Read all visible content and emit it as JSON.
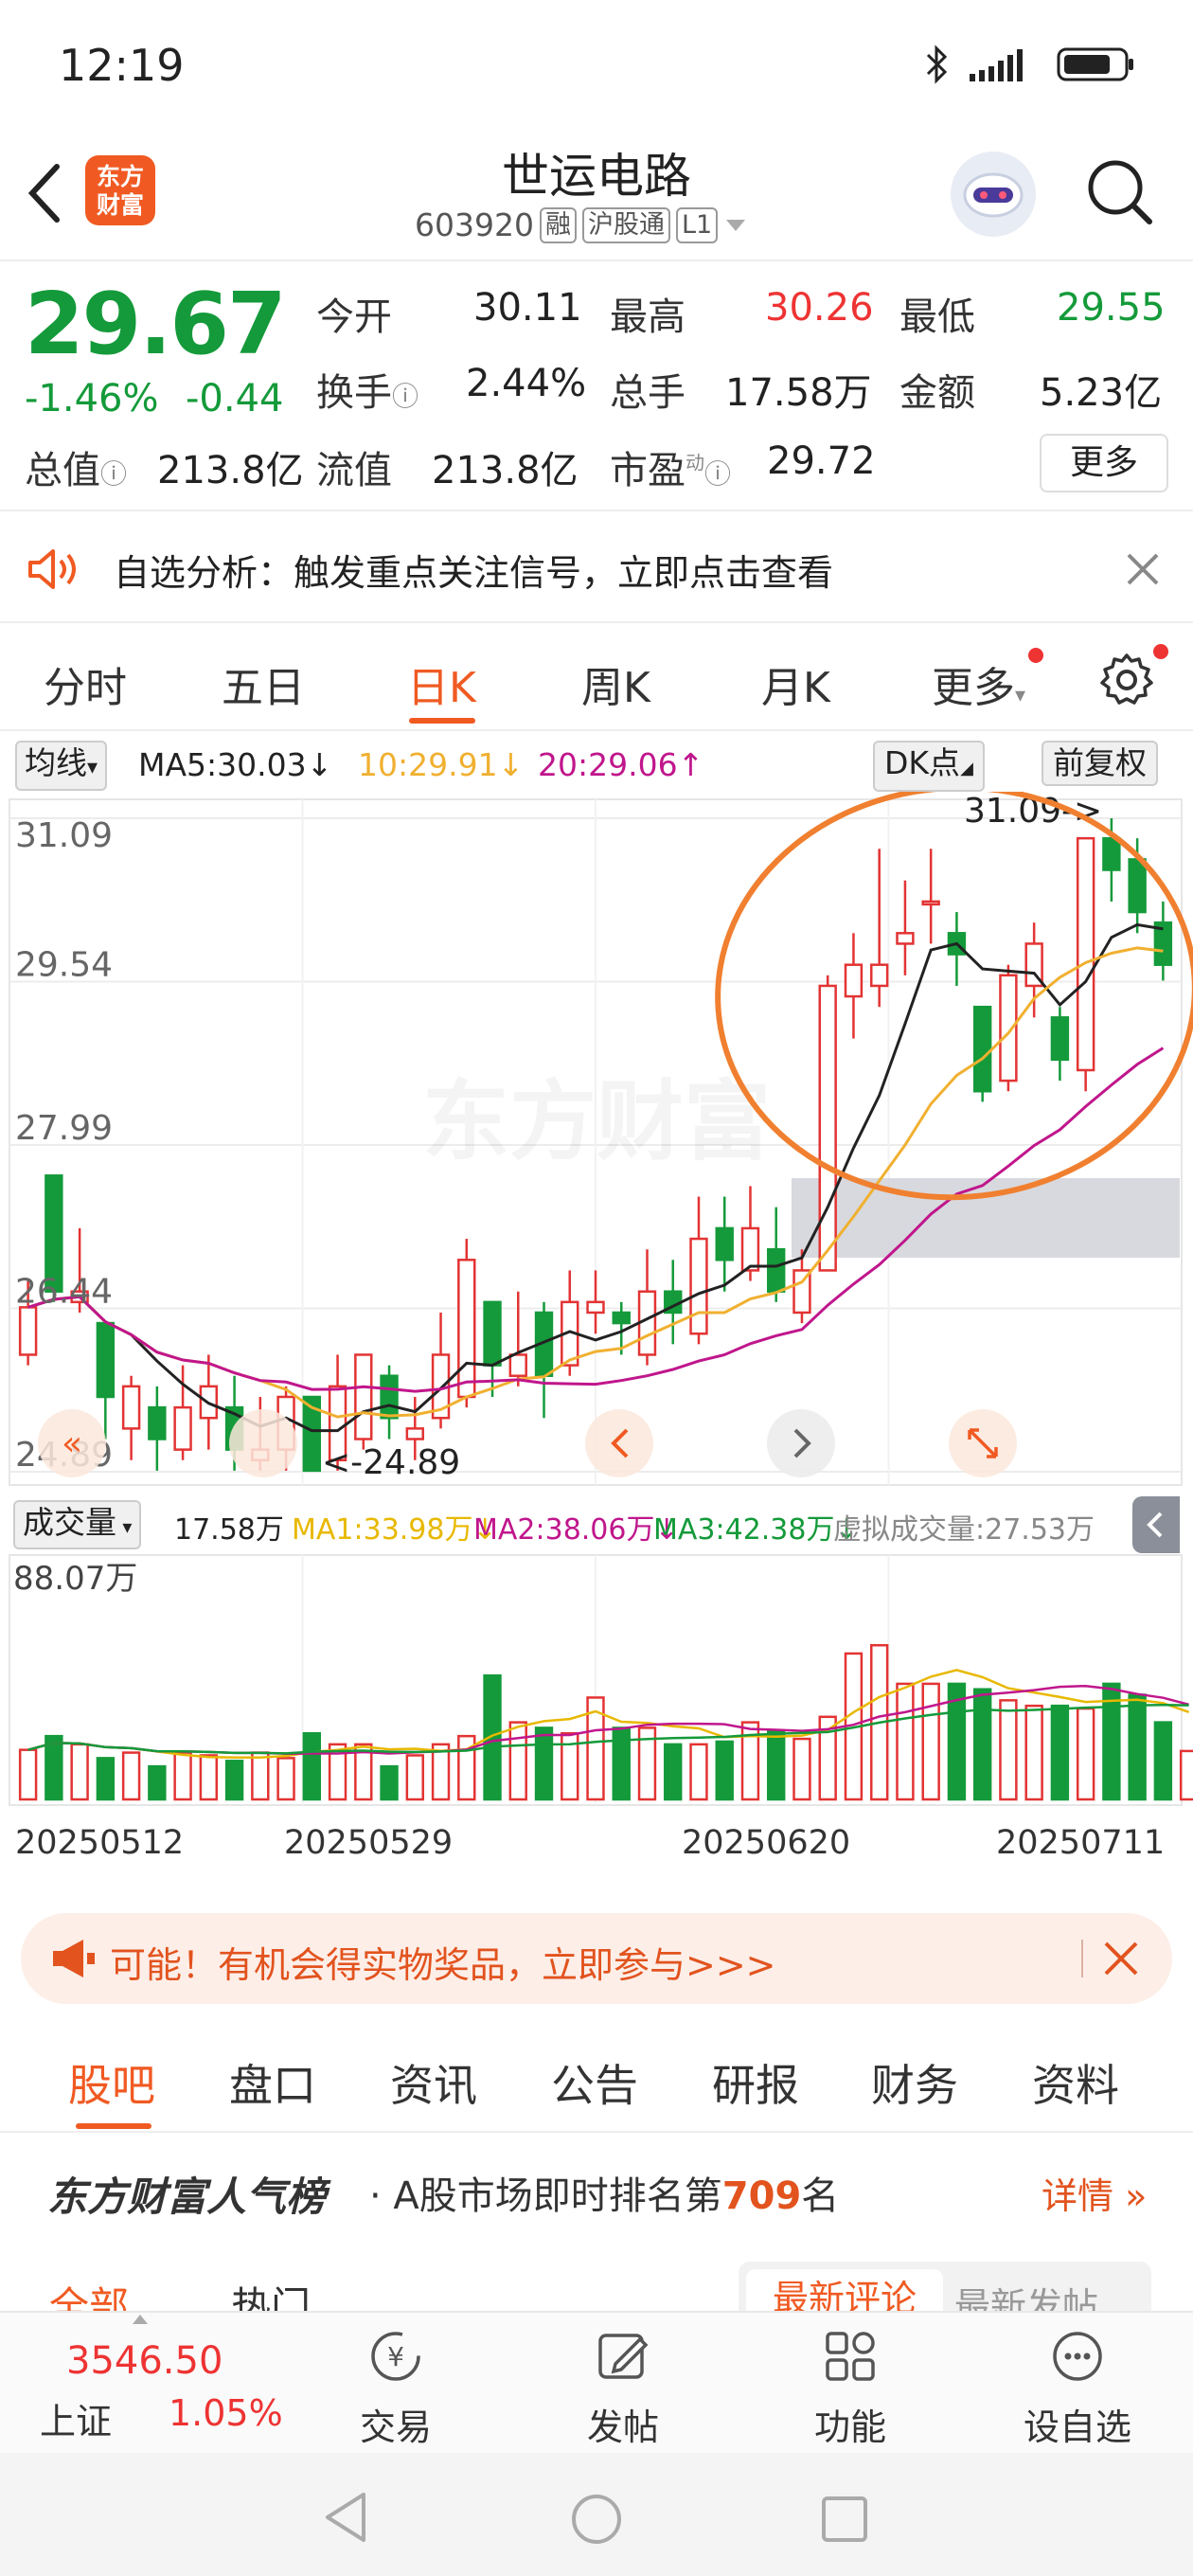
{
  "status_bar": {
    "time": "12:19"
  },
  "header": {
    "title": "世运电路",
    "code": "603920",
    "tags": [
      "融",
      "沪股通",
      "L1"
    ],
    "logo_text": "东方财富"
  },
  "quote": {
    "price": "29.67",
    "change_pct": "-1.46%",
    "change": "-0.44",
    "fields": [
      {
        "label": "今开",
        "value": "30.11"
      },
      {
        "label": "最高",
        "value": "30.26"
      },
      {
        "label": "最低",
        "value": "29.55"
      },
      {
        "label": "换手",
        "value": "2.44%"
      },
      {
        "label": "总手",
        "value": "17.58万"
      },
      {
        "label": "金额",
        "value": "5.23亿"
      },
      {
        "label": "总值",
        "value": "213.8亿"
      },
      {
        "label": "流值",
        "value": "213.8亿"
      },
      {
        "label": "市盈",
        "sup": "动",
        "value": "29.72"
      }
    ],
    "more_label": "更多"
  },
  "notice": {
    "text": "自选分析：触发重点关注信号，立即点击查看"
  },
  "period_tabs": [
    "分时",
    "五日",
    "日K",
    "周K",
    "月K",
    "更多"
  ],
  "active_period": "日K",
  "ma_legend": {
    "selector": "均线",
    "ma5": "MA5:30.03↓",
    "ma10": "10:29.91↓",
    "ma20": "20:29.06↑",
    "dk_label": "DK点",
    "adjust_label": "前复权"
  },
  "kline": {
    "y_ticks": [
      "31.09",
      "29.54",
      "27.99",
      "26.44",
      "24.89"
    ],
    "high_marker": "31.09->",
    "low_marker": "<-24.89",
    "watermark": "东方财富",
    "colors": {
      "up": "#e33333",
      "down": "#149a3a",
      "ma5": "#222222",
      "ma10": "#f0b030",
      "ma20": "#c0168c",
      "annotation": "#f08030"
    }
  },
  "volume": {
    "selector": "成交量",
    "current": "17.58万",
    "ma1": "MA1:33.98万↓",
    "ma2": "MA2:38.06万↓",
    "ma3": "MA3:42.38万↓",
    "virtual": "虚拟成交量:27.53万",
    "y_max_label": "88.07万"
  },
  "dates": [
    "20250512",
    "20250529",
    "20250620",
    "20250711"
  ],
  "chart_data": {
    "type": "candlestick",
    "ylim": [
      24.89,
      31.09
    ],
    "candles": [
      {
        "o": 26.0,
        "c": 26.45,
        "h": 26.7,
        "l": 25.9
      },
      {
        "o": 27.7,
        "c": 26.6,
        "h": 27.7,
        "l": 26.5
      },
      {
        "o": 26.5,
        "c": 26.6,
        "h": 27.2,
        "l": 26.4
      },
      {
        "o": 26.3,
        "c": 25.6,
        "h": 26.3,
        "l": 25.2
      },
      {
        "o": 25.3,
        "c": 25.7,
        "h": 25.8,
        "l": 25.0
      },
      {
        "o": 25.5,
        "c": 25.2,
        "h": 25.7,
        "l": 24.9
      },
      {
        "o": 25.1,
        "c": 25.5,
        "h": 25.9,
        "l": 25.0
      },
      {
        "o": 25.4,
        "c": 25.7,
        "h": 26.0,
        "l": 25.1
      },
      {
        "o": 25.5,
        "c": 25.1,
        "h": 25.8,
        "l": 24.9
      },
      {
        "o": 25.0,
        "c": 25.1,
        "h": 25.6,
        "l": 24.9
      },
      {
        "o": 25.1,
        "c": 25.6,
        "h": 25.7,
        "l": 24.9
      },
      {
        "o": 25.6,
        "c": 24.9,
        "h": 25.6,
        "l": 24.89
      },
      {
        "o": 25.0,
        "c": 25.7,
        "h": 26.0,
        "l": 24.9
      },
      {
        "o": 25.2,
        "c": 26.0,
        "h": 26.0,
        "l": 25.1
      },
      {
        "o": 25.8,
        "c": 25.4,
        "h": 25.9,
        "l": 25.2
      },
      {
        "o": 25.2,
        "c": 25.3,
        "h": 25.6,
        "l": 25.0
      },
      {
        "o": 25.4,
        "c": 26.0,
        "h": 26.4,
        "l": 25.3
      },
      {
        "o": 25.6,
        "c": 26.9,
        "h": 27.1,
        "l": 25.5
      },
      {
        "o": 26.5,
        "c": 25.9,
        "h": 26.5,
        "l": 25.6
      },
      {
        "o": 25.8,
        "c": 26.0,
        "h": 26.6,
        "l": 25.7
      },
      {
        "o": 26.4,
        "c": 25.8,
        "h": 26.5,
        "l": 25.4
      },
      {
        "o": 25.9,
        "c": 26.5,
        "h": 26.8,
        "l": 25.8
      },
      {
        "o": 26.4,
        "c": 26.5,
        "h": 26.8,
        "l": 26.2
      },
      {
        "o": 26.4,
        "c": 26.3,
        "h": 26.5,
        "l": 26.0
      },
      {
        "o": 26.0,
        "c": 26.6,
        "h": 27.0,
        "l": 25.9
      },
      {
        "o": 26.6,
        "c": 26.4,
        "h": 26.9,
        "l": 26.1
      },
      {
        "o": 26.2,
        "c": 27.1,
        "h": 27.5,
        "l": 26.1
      },
      {
        "o": 27.2,
        "c": 26.9,
        "h": 27.5,
        "l": 26.6
      },
      {
        "o": 26.8,
        "c": 27.2,
        "h": 27.6,
        "l": 26.7
      },
      {
        "o": 27.0,
        "c": 26.6,
        "h": 27.4,
        "l": 26.5
      },
      {
        "o": 26.4,
        "c": 26.8,
        "h": 27.0,
        "l": 26.3
      },
      {
        "o": 26.8,
        "c": 29.5,
        "h": 29.6,
        "l": 26.8
      },
      {
        "o": 29.4,
        "c": 29.7,
        "h": 30.0,
        "l": 29.0
      },
      {
        "o": 29.5,
        "c": 29.7,
        "h": 30.8,
        "l": 29.3
      },
      {
        "o": 29.9,
        "c": 30.0,
        "h": 30.5,
        "l": 29.6
      },
      {
        "o": 30.3,
        "c": 30.3,
        "h": 30.8,
        "l": 29.9
      },
      {
        "o": 30.0,
        "c": 29.8,
        "h": 30.2,
        "l": 29.5
      },
      {
        "o": 29.3,
        "c": 28.5,
        "h": 29.3,
        "l": 28.4
      },
      {
        "o": 28.6,
        "c": 29.6,
        "h": 29.7,
        "l": 28.5
      },
      {
        "o": 29.5,
        "c": 29.9,
        "h": 30.1,
        "l": 29.2
      },
      {
        "o": 29.2,
        "c": 28.8,
        "h": 29.3,
        "l": 28.6
      },
      {
        "o": 28.7,
        "c": 30.9,
        "h": 30.9,
        "l": 28.5
      },
      {
        "o": 30.9,
        "c": 30.6,
        "h": 31.09,
        "l": 30.3
      },
      {
        "o": 30.7,
        "c": 30.2,
        "h": 30.9,
        "l": 30.0
      },
      {
        "o": 30.1,
        "c": 29.7,
        "h": 30.3,
        "l": 29.55
      }
    ],
    "volume_ylim": [
      0,
      88.07
    ],
    "volumes": [
      18,
      23,
      20,
      15,
      17,
      12,
      17,
      16,
      14,
      17,
      15,
      24,
      20,
      20,
      12,
      16,
      20,
      23,
      45,
      28,
      26,
      24,
      37,
      26,
      26,
      20,
      20,
      21,
      28,
      25,
      22,
      30,
      53,
      56,
      42,
      42,
      42,
      40,
      36,
      34,
      34,
      33,
      42,
      38,
      28,
      17.58
    ]
  }
}
